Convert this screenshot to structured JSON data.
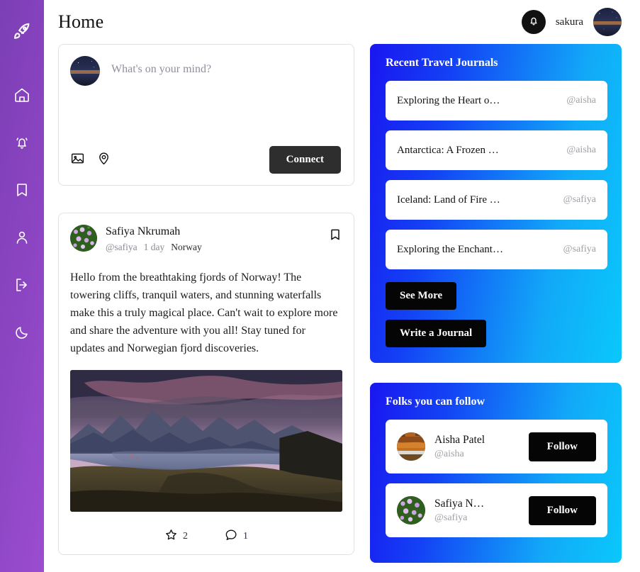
{
  "sidebar": {
    "logo_icon": "rocket-icon",
    "items": [
      {
        "icon": "home-icon",
        "label": "Home"
      },
      {
        "icon": "bell-icon",
        "label": "Notifications"
      },
      {
        "icon": "bookmark-icon",
        "label": "Bookmarks"
      },
      {
        "icon": "person-icon",
        "label": "Profile"
      },
      {
        "icon": "logout-icon",
        "label": "Logout"
      },
      {
        "icon": "moon-icon",
        "label": "Dark mode"
      }
    ],
    "gradient_from": "#7b3fb5",
    "gradient_to": "#9b4dd0"
  },
  "header": {
    "title": "Home",
    "notification_icon": "bell-icon",
    "username": "sakura",
    "avatar_icon": "user-avatar"
  },
  "composer": {
    "avatar_icon": "user-avatar",
    "placeholder": "What's on your mind?",
    "image_icon": "image-icon",
    "location_icon": "location-pin-icon",
    "submit_label": "Connect"
  },
  "post": {
    "avatar_icon": "flowers-avatar",
    "author": "Safiya Nkrumah",
    "handle": "@safiya",
    "time": "1 day",
    "location": "Norway",
    "bookmark_icon": "bookmark-icon",
    "body": "Hello from the breathtaking fjords of Norway! The towering cliffs, tranquil waters, and stunning waterfalls make this a truly magical place. Can't wait to explore more and share the adventure with you all! Stay tuned for updates and Norwegian fjord discoveries.",
    "image_alt": "Norwegian fjord landscape at dusk",
    "star_icon": "star-icon",
    "star_count": "2",
    "comment_icon": "comment-icon",
    "comment_count": "1"
  },
  "journals_panel": {
    "title": "Recent Travel Journals",
    "gradient_from": "#1a16f0",
    "gradient_to": "#0ac8fb",
    "items": [
      {
        "title": "Exploring the Heart o…",
        "handle": "@aisha"
      },
      {
        "title": "Antarctica: A Frozen …",
        "handle": "@aisha"
      },
      {
        "title": "Iceland: Land of Fire …",
        "handle": "@safiya"
      },
      {
        "title": "Exploring the Enchant…",
        "handle": "@safiya"
      }
    ],
    "see_more_label": "See More",
    "write_label": "Write a Journal"
  },
  "follow_panel": {
    "title": "Folks you can follow",
    "items": [
      {
        "avatar_icon": "canyon-avatar",
        "name": "Aisha Patel",
        "handle": "@aisha",
        "button": "Follow"
      },
      {
        "avatar_icon": "flowers-avatar",
        "name": "Safiya N…",
        "handle": "@safiya",
        "button": "Follow"
      }
    ]
  }
}
